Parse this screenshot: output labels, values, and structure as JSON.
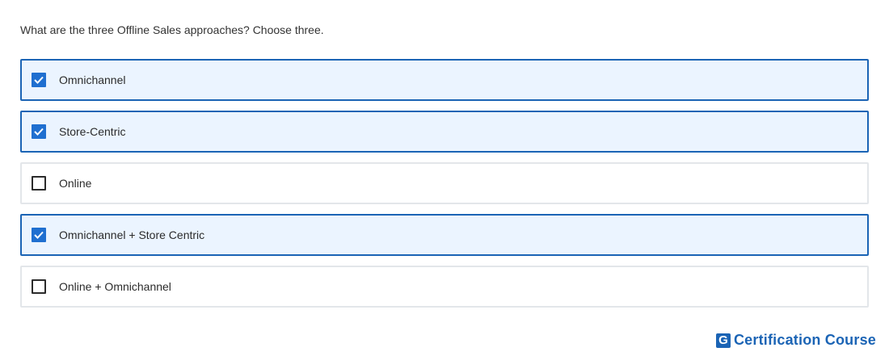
{
  "question": {
    "text": "What are the three Offline Sales approaches? Choose three."
  },
  "options": [
    {
      "label": "Omnichannel",
      "checked": true
    },
    {
      "label": "Store-Centric",
      "checked": true
    },
    {
      "label": "Online",
      "checked": false
    },
    {
      "label": "Omnichannel + Store Centric",
      "checked": true
    },
    {
      "label": "Online + Omnichannel",
      "checked": false
    }
  ],
  "brand": {
    "logo_letter": "G",
    "name": "Certification Course"
  },
  "colors": {
    "accent": "#1b64b5",
    "checkbox_fill": "#1f6fd0",
    "selected_background": "#ebf4ff",
    "unselected_border": "#e3e6ea"
  },
  "icons": {
    "checked": "checkmark-icon"
  }
}
